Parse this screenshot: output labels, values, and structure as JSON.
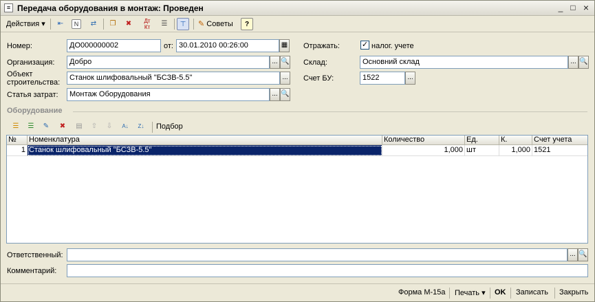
{
  "window": {
    "title": "Передача оборудования в монтаж: Проведен",
    "icon": "document-icon",
    "controls": [
      "_",
      "□",
      "×"
    ]
  },
  "toolbar": {
    "actions_label": "Действия",
    "advice_label": "Советы",
    "help_label": "?",
    "dtkt_label": "Дт Кт"
  },
  "form": {
    "number_label": "Номер:",
    "number_value": "ДО000000002",
    "date_label": "от:",
    "date_value": "30.01.2010 00:26:00",
    "reflect_label": "Отражать:",
    "tax_label": "налог. учете",
    "tax_checked": "✓",
    "org_label": "Организация:",
    "org_value": "Добро",
    "warehouse_label": "Склад:",
    "warehouse_value": "Основний склад",
    "object_label_1": "Объект",
    "object_label_2": "строительства:",
    "object_value": "Станок шлифовальный \"БСЗВ-5.5\"",
    "account_label": "Счет БУ:",
    "account_value": "1522",
    "cost_label": "Статья затрат:",
    "cost_value": "Монтаж Оборудования"
  },
  "equipment": {
    "section_title": "Оборудование",
    "select_label": "Подбор",
    "columns": [
      "№",
      "Номенклатура",
      "Количество",
      "Ед.",
      "К.",
      "Счет учета"
    ],
    "rows": [
      {
        "n": "1",
        "name": "Станок шлифовальный \"БСЗВ-5.5\"",
        "qty": "1,000",
        "unit": "шт",
        "k": "1,000",
        "account": "1521"
      }
    ]
  },
  "footer_fields": {
    "responsible_label": "Ответственный:",
    "responsible_value": "",
    "comment_label": "Комментарий:",
    "comment_value": ""
  },
  "bottombar": {
    "form_label": "Форма М-15а",
    "print_label": "Печать",
    "ok_label": "OK",
    "save_label": "Записать",
    "close_label": "Закрыть"
  },
  "glyphs": {
    "ellipsis": "...",
    "search": "🔍",
    "calendar": "▦",
    "dropdown": "▾"
  }
}
